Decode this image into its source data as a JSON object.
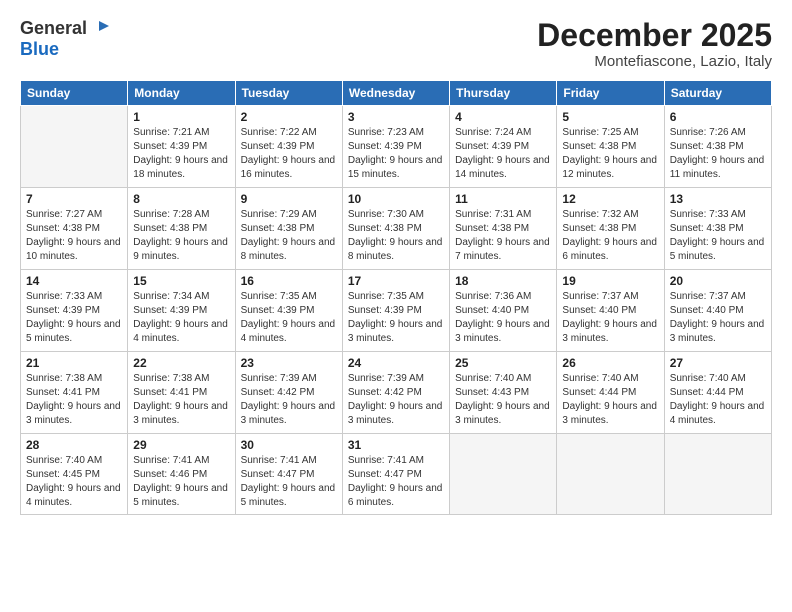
{
  "logo": {
    "general": "General",
    "blue": "Blue"
  },
  "header": {
    "month": "December 2025",
    "location": "Montefiascone, Lazio, Italy"
  },
  "weekdays": [
    "Sunday",
    "Monday",
    "Tuesday",
    "Wednesday",
    "Thursday",
    "Friday",
    "Saturday"
  ],
  "weeks": [
    [
      {
        "day": "",
        "sunrise": "",
        "sunset": "",
        "daylight": "",
        "empty": true
      },
      {
        "day": "1",
        "sunrise": "Sunrise: 7:21 AM",
        "sunset": "Sunset: 4:39 PM",
        "daylight": "Daylight: 9 hours and 18 minutes."
      },
      {
        "day": "2",
        "sunrise": "Sunrise: 7:22 AM",
        "sunset": "Sunset: 4:39 PM",
        "daylight": "Daylight: 9 hours and 16 minutes."
      },
      {
        "day": "3",
        "sunrise": "Sunrise: 7:23 AM",
        "sunset": "Sunset: 4:39 PM",
        "daylight": "Daylight: 9 hours and 15 minutes."
      },
      {
        "day": "4",
        "sunrise": "Sunrise: 7:24 AM",
        "sunset": "Sunset: 4:39 PM",
        "daylight": "Daylight: 9 hours and 14 minutes."
      },
      {
        "day": "5",
        "sunrise": "Sunrise: 7:25 AM",
        "sunset": "Sunset: 4:38 PM",
        "daylight": "Daylight: 9 hours and 12 minutes."
      },
      {
        "day": "6",
        "sunrise": "Sunrise: 7:26 AM",
        "sunset": "Sunset: 4:38 PM",
        "daylight": "Daylight: 9 hours and 11 minutes."
      }
    ],
    [
      {
        "day": "7",
        "sunrise": "Sunrise: 7:27 AM",
        "sunset": "Sunset: 4:38 PM",
        "daylight": "Daylight: 9 hours and 10 minutes."
      },
      {
        "day": "8",
        "sunrise": "Sunrise: 7:28 AM",
        "sunset": "Sunset: 4:38 PM",
        "daylight": "Daylight: 9 hours and 9 minutes."
      },
      {
        "day": "9",
        "sunrise": "Sunrise: 7:29 AM",
        "sunset": "Sunset: 4:38 PM",
        "daylight": "Daylight: 9 hours and 8 minutes."
      },
      {
        "day": "10",
        "sunrise": "Sunrise: 7:30 AM",
        "sunset": "Sunset: 4:38 PM",
        "daylight": "Daylight: 9 hours and 8 minutes."
      },
      {
        "day": "11",
        "sunrise": "Sunrise: 7:31 AM",
        "sunset": "Sunset: 4:38 PM",
        "daylight": "Daylight: 9 hours and 7 minutes."
      },
      {
        "day": "12",
        "sunrise": "Sunrise: 7:32 AM",
        "sunset": "Sunset: 4:38 PM",
        "daylight": "Daylight: 9 hours and 6 minutes."
      },
      {
        "day": "13",
        "sunrise": "Sunrise: 7:33 AM",
        "sunset": "Sunset: 4:38 PM",
        "daylight": "Daylight: 9 hours and 5 minutes."
      }
    ],
    [
      {
        "day": "14",
        "sunrise": "Sunrise: 7:33 AM",
        "sunset": "Sunset: 4:39 PM",
        "daylight": "Daylight: 9 hours and 5 minutes."
      },
      {
        "day": "15",
        "sunrise": "Sunrise: 7:34 AM",
        "sunset": "Sunset: 4:39 PM",
        "daylight": "Daylight: 9 hours and 4 minutes."
      },
      {
        "day": "16",
        "sunrise": "Sunrise: 7:35 AM",
        "sunset": "Sunset: 4:39 PM",
        "daylight": "Daylight: 9 hours and 4 minutes."
      },
      {
        "day": "17",
        "sunrise": "Sunrise: 7:35 AM",
        "sunset": "Sunset: 4:39 PM",
        "daylight": "Daylight: 9 hours and 3 minutes."
      },
      {
        "day": "18",
        "sunrise": "Sunrise: 7:36 AM",
        "sunset": "Sunset: 4:40 PM",
        "daylight": "Daylight: 9 hours and 3 minutes."
      },
      {
        "day": "19",
        "sunrise": "Sunrise: 7:37 AM",
        "sunset": "Sunset: 4:40 PM",
        "daylight": "Daylight: 9 hours and 3 minutes."
      },
      {
        "day": "20",
        "sunrise": "Sunrise: 7:37 AM",
        "sunset": "Sunset: 4:40 PM",
        "daylight": "Daylight: 9 hours and 3 minutes."
      }
    ],
    [
      {
        "day": "21",
        "sunrise": "Sunrise: 7:38 AM",
        "sunset": "Sunset: 4:41 PM",
        "daylight": "Daylight: 9 hours and 3 minutes."
      },
      {
        "day": "22",
        "sunrise": "Sunrise: 7:38 AM",
        "sunset": "Sunset: 4:41 PM",
        "daylight": "Daylight: 9 hours and 3 minutes."
      },
      {
        "day": "23",
        "sunrise": "Sunrise: 7:39 AM",
        "sunset": "Sunset: 4:42 PM",
        "daylight": "Daylight: 9 hours and 3 minutes."
      },
      {
        "day": "24",
        "sunrise": "Sunrise: 7:39 AM",
        "sunset": "Sunset: 4:42 PM",
        "daylight": "Daylight: 9 hours and 3 minutes."
      },
      {
        "day": "25",
        "sunrise": "Sunrise: 7:40 AM",
        "sunset": "Sunset: 4:43 PM",
        "daylight": "Daylight: 9 hours and 3 minutes."
      },
      {
        "day": "26",
        "sunrise": "Sunrise: 7:40 AM",
        "sunset": "Sunset: 4:44 PM",
        "daylight": "Daylight: 9 hours and 3 minutes."
      },
      {
        "day": "27",
        "sunrise": "Sunrise: 7:40 AM",
        "sunset": "Sunset: 4:44 PM",
        "daylight": "Daylight: 9 hours and 4 minutes."
      }
    ],
    [
      {
        "day": "28",
        "sunrise": "Sunrise: 7:40 AM",
        "sunset": "Sunset: 4:45 PM",
        "daylight": "Daylight: 9 hours and 4 minutes."
      },
      {
        "day": "29",
        "sunrise": "Sunrise: 7:41 AM",
        "sunset": "Sunset: 4:46 PM",
        "daylight": "Daylight: 9 hours and 5 minutes."
      },
      {
        "day": "30",
        "sunrise": "Sunrise: 7:41 AM",
        "sunset": "Sunset: 4:47 PM",
        "daylight": "Daylight: 9 hours and 5 minutes."
      },
      {
        "day": "31",
        "sunrise": "Sunrise: 7:41 AM",
        "sunset": "Sunset: 4:47 PM",
        "daylight": "Daylight: 9 hours and 6 minutes."
      },
      {
        "day": "",
        "sunrise": "",
        "sunset": "",
        "daylight": "",
        "empty": true
      },
      {
        "day": "",
        "sunrise": "",
        "sunset": "",
        "daylight": "",
        "empty": true
      },
      {
        "day": "",
        "sunrise": "",
        "sunset": "",
        "daylight": "",
        "empty": true
      }
    ]
  ]
}
